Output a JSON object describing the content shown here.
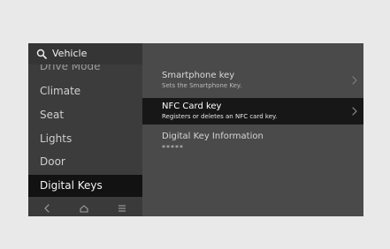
{
  "search": {
    "title": "Vehicle",
    "icon": "search-icon"
  },
  "sidebar": {
    "items": [
      {
        "label": "Drive Mode",
        "state": "partially hidden"
      },
      {
        "label": "Climate"
      },
      {
        "label": "Seat"
      },
      {
        "label": "Lights"
      },
      {
        "label": "Door"
      },
      {
        "label": "Digital Keys",
        "selected": true
      }
    ]
  },
  "bottom_nav": {
    "items": [
      {
        "icon": "back-icon"
      },
      {
        "icon": "home-icon"
      },
      {
        "icon": "menu-icon"
      }
    ]
  },
  "content": {
    "rows": [
      {
        "title": "Smartphone key",
        "subtitle": "Sets the Smartphone Key.",
        "icon": "chevron-right-icon"
      },
      {
        "title": "NFC Card key",
        "subtitle": "Registers or deletes an NFC card key.",
        "icon": "chevron-right-icon",
        "selected": true
      },
      {
        "title": "Digital Key Information",
        "value": "*****"
      }
    ]
  },
  "colors": {
    "background": "#e9e9e9",
    "screen": "#4a4a4a",
    "sidebar": "#3c3c3c",
    "active": "#121212",
    "text": "#cfcfcf"
  }
}
